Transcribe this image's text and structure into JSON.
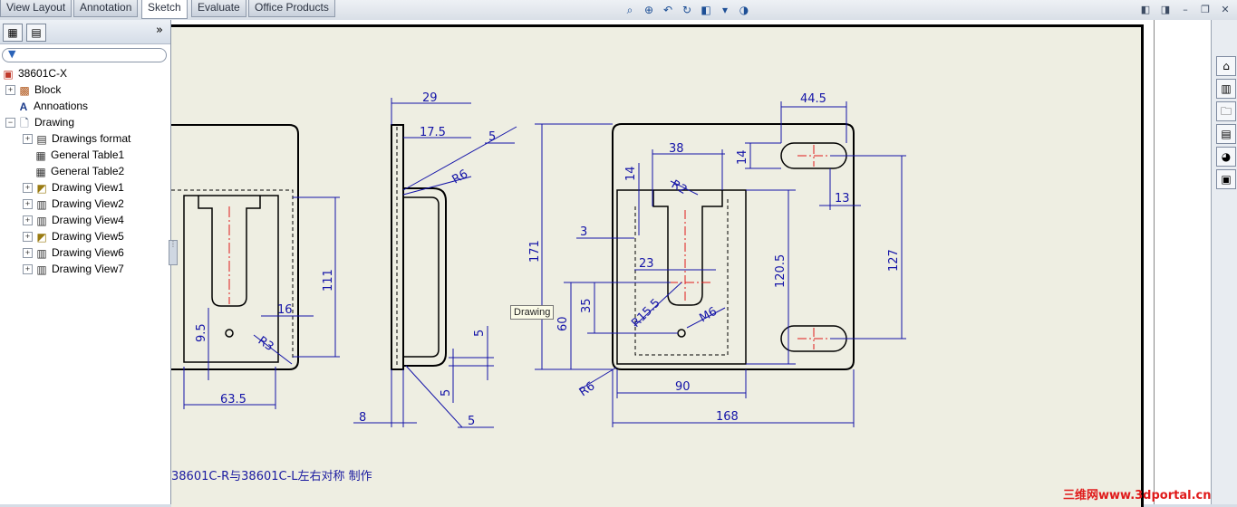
{
  "tabs": [
    "View Layout",
    "Annotation",
    "Sketch",
    "Evaluate",
    "Office Products"
  ],
  "active_tab": "Sketch",
  "tree": {
    "root": "38601C-X",
    "items": [
      {
        "label": "Block",
        "icon": "block-icon"
      },
      {
        "label": "Annoations",
        "icon": "annotation-icon"
      },
      {
        "label": "Drawing",
        "icon": "drawing-icon"
      },
      {
        "label": "Drawings format",
        "icon": "sheet-format-icon"
      },
      {
        "label": "General Table1",
        "icon": "table-icon"
      },
      {
        "label": "General Table2",
        "icon": "table-icon"
      },
      {
        "label": "Drawing View1",
        "icon": "drawing-view-icon"
      },
      {
        "label": "Drawing View2",
        "icon": "drawing-view-icon"
      },
      {
        "label": "Drawing View4",
        "icon": "drawing-view-icon"
      },
      {
        "label": "Drawing View5",
        "icon": "drawing-view-icon"
      },
      {
        "label": "Drawing View6",
        "icon": "drawing-view-icon"
      },
      {
        "label": "Drawing View7",
        "icon": "drawing-view-icon"
      }
    ]
  },
  "panel_collapse": "»",
  "dimensions": {
    "d29": "29",
    "d17_5": "17.5",
    "d5a": "5",
    "dR6a": "R6",
    "d111": "111",
    "d16": "16",
    "d9_5": "9.5",
    "dR3": "R3",
    "d63_5": "63.5",
    "d8": "8",
    "d5b": "5",
    "d5c": "5",
    "d5d": "5",
    "d171": "171",
    "d38": "38",
    "dR2": "R2",
    "d14a": "14",
    "d3": "3",
    "d23": "23",
    "d35": "35",
    "d60": "60",
    "dR15_5": "R15.5",
    "dM6": "M6",
    "d120_5": "120.5",
    "dR6b": "R6",
    "d90": "90",
    "d168": "168",
    "d44_5": "44.5",
    "d14b": "14",
    "d13": "13",
    "d127": "127"
  },
  "note": "38601C-R与38601C-L左右对称 制作",
  "tooltip": "Drawing",
  "watermark": "三维网www.3dportal.cn",
  "colors": {
    "dimension": "#1414a8",
    "sheet": "#eeeee2",
    "centerline": "#e01a1a"
  }
}
